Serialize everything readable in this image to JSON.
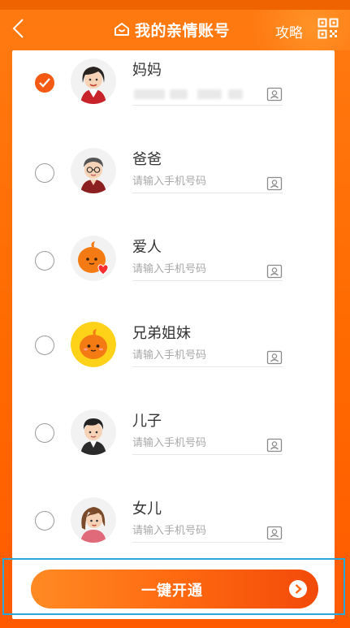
{
  "header": {
    "title": "我的亲情账号",
    "strategy_label": "攻略"
  },
  "relatives": [
    {
      "name": "妈妈",
      "selected": true,
      "phone_masked": true,
      "placeholder": ""
    },
    {
      "name": "爸爸",
      "selected": false,
      "phone_masked": false,
      "placeholder": "请输入手机号码"
    },
    {
      "name": "爱人",
      "selected": false,
      "phone_masked": false,
      "placeholder": "请输入手机号码"
    },
    {
      "name": "兄弟姐妹",
      "selected": false,
      "phone_masked": false,
      "placeholder": "请输入手机号码"
    },
    {
      "name": "儿子",
      "selected": false,
      "phone_masked": false,
      "placeholder": "请输入手机号码"
    },
    {
      "name": "女儿",
      "selected": false,
      "phone_masked": false,
      "placeholder": "请输入手机号码"
    }
  ],
  "cta": {
    "label": "一键开通"
  },
  "icons": {
    "back": "chevron-left-icon",
    "title": "house-icon",
    "qr": "qr-code-icon",
    "contact": "contact-book-icon",
    "cta_arrow": "chevron-right-circle-icon",
    "check": "check-icon"
  },
  "colors": {
    "brand_orange": "#ff6a00",
    "selected_radio": "#f45a13",
    "highlight_frame": "#2aa7d8"
  }
}
